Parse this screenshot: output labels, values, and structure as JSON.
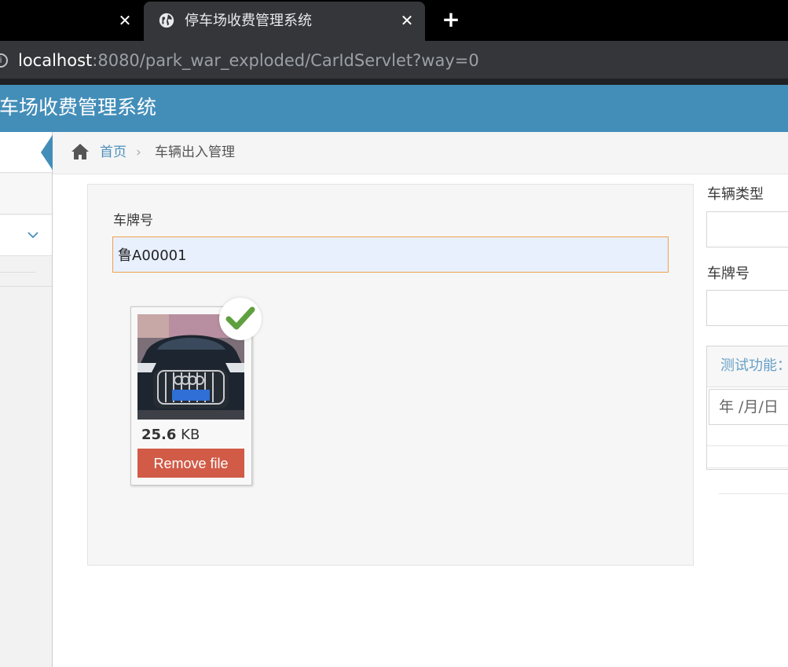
{
  "browser": {
    "tab_title": "停车场收费管理系统",
    "tab_close": "✕",
    "prev_tab_close": "✕",
    "new_tab": "+",
    "url_host": "localhost",
    "url_rest": ":8080/park_war_exploded/CarIdServlet?way=0",
    "info_icon": "i"
  },
  "header": {
    "app_title": "停车场收费管理系统"
  },
  "breadcrumb": {
    "home": "首页",
    "separator": "›",
    "current": "车辆出入管理"
  },
  "form": {
    "plate_label": "车牌号",
    "plate_value": "鲁A00001"
  },
  "upload": {
    "size_value": "25.6",
    "size_unit": "KB",
    "remove_label": "Remove file",
    "status": "success"
  },
  "right_panel": {
    "vehicle_type_label": "车辆类型",
    "plate_label": "车牌号",
    "widget_title": "测试功能：",
    "date_placeholder": "年 /月/日"
  },
  "colors": {
    "header_blue": "#438eb9",
    "link_blue": "#4c8fbd",
    "remove_red": "#d15b47",
    "success_green": "#5fa03e"
  }
}
